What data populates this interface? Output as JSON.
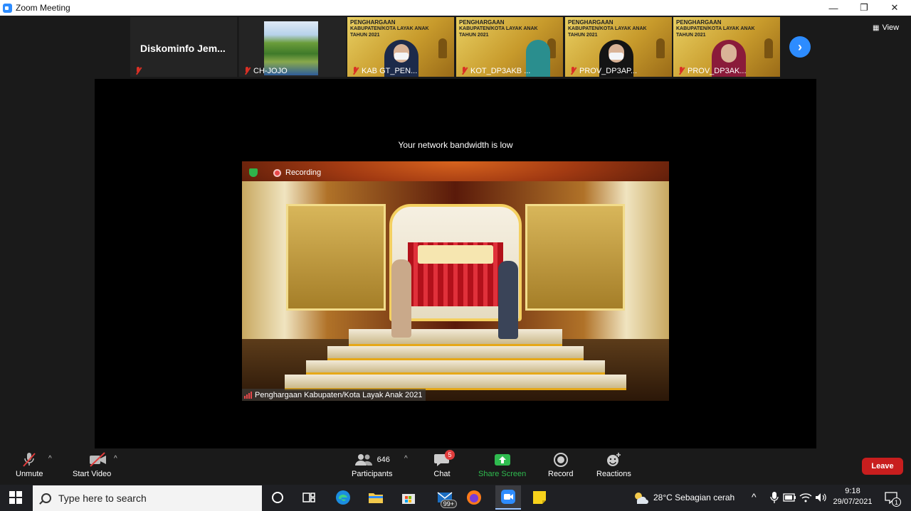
{
  "window": {
    "title": "Zoom Meeting",
    "minimize": "—",
    "restore": "❐",
    "close": "✕"
  },
  "gallery": {
    "tiles": [
      {
        "name": "Diskominfo  Jem..."
      },
      {
        "name": "CH-JOJO"
      },
      {
        "name": "KAB GT_PEN..."
      },
      {
        "name": "KOT_DP3AKB ..."
      },
      {
        "name": "PROV_DP3AP..."
      },
      {
        "name": "PROV_DP3AK..."
      }
    ],
    "award_title": "PENGHARGAAN",
    "award_sub": "KABUPATEN/KOTA LAYAK ANAK",
    "award_year": "TAHUN 2021",
    "next_arrow": "›",
    "view_label": "View"
  },
  "stage": {
    "network_notice": "Your network bandwidth is low",
    "recording_label": "Recording",
    "caption": "Penghargaan Kabupaten/Kota Layak Anak 2021"
  },
  "controls": {
    "unmute": "Unmute",
    "start_video": "Start Video",
    "participants": "Participants",
    "participant_count": "646",
    "chat": "Chat",
    "chat_badge": "5",
    "share_screen": "Share Screen",
    "record": "Record",
    "reactions": "Reactions",
    "leave": "Leave",
    "colors": {
      "share_green": "#2fbb4f",
      "leave_red": "#c81e1e",
      "accent_blue": "#2d8cff"
    }
  },
  "taskbar": {
    "search_placeholder": "Type here to search",
    "mail_badge": "99+",
    "weather": "28°C  Sebagian cerah",
    "time": "9:18",
    "date": "29/07/2021",
    "notification_count": "1"
  }
}
